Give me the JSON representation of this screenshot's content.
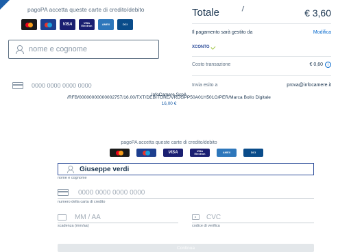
{
  "top": {
    "accept_text": "pagoPA accetta queste carte di credito/debito",
    "name_placeholder": "nome e cognome",
    "card_number_placeholder": "0000 0000 0000 0000"
  },
  "summary": {
    "total_label": "Totale",
    "total_value": "€ 3,60",
    "managed_by": "Il pagamento sarà gestito da",
    "modify_link": "Modifica",
    "psp_name": "XCONTO",
    "fee_label": "Costo transazione",
    "fee_value": "€ 0,60",
    "receipt_label": "Invia esito a",
    "receipt_email": "prova@infocamere.it"
  },
  "front": {
    "company": "InfoCamere ScpA",
    "payment_reference": "/RFB/00000000000002757/16.00/TXT/DEBITORE/VRDGPP50A01H501O/PER/Marca Bollo Digitale",
    "amount": "16,00 €",
    "accept_text": "pagoPA accetta queste carte di credito/debito",
    "name_value": "Giuseppe verdi",
    "name_caption": "nome e cognome",
    "card_number_placeholder": "0000 0000 0000 0000",
    "card_number_caption": "numero della carta di credito",
    "expiry_placeholder": "MM / AA",
    "expiry_caption": "scadenza (mm/aa)",
    "cvc_placeholder": "CVC",
    "cvc_caption": "codice di verifica",
    "continue_label": "Continua"
  },
  "cards": [
    "mastercard-icon",
    "maestro-icon",
    "visa-icon",
    "visa-electron-icon",
    "amex-icon",
    "diners-icon"
  ],
  "colors": {
    "accent": "#0066cc",
    "text": "#17324d",
    "muted": "#5c6f82",
    "brand": "#1c5ea8"
  }
}
